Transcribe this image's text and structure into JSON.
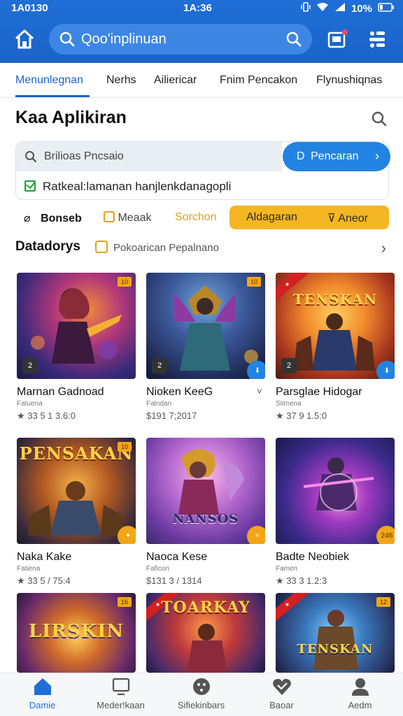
{
  "status": {
    "time_left": "1A0130",
    "time_mid": "1A:36",
    "battery": "10%"
  },
  "header": {
    "search_placeholder": "Qoo'inplinuan"
  },
  "tabs": [
    {
      "label": "Menunlegnan",
      "active": true
    },
    {
      "label": "Nerhs",
      "active": false
    },
    {
      "label": "Ailiericar",
      "active": false
    },
    {
      "label": "Fnim Pencakon",
      "active": false
    },
    {
      "label": "Flynushiqnas",
      "active": false
    }
  ],
  "section": {
    "title": "Kaa Aplikiran"
  },
  "promo": {
    "input_text": "Brilioas Pncsaio",
    "button_label": "Pencaran",
    "button_prefix": "D",
    "note": "Ratkeal:lamanan hanjlenkdanagopli"
  },
  "chips": {
    "c1": "Bonseb",
    "c2": "Meaak",
    "c3": "Sorchon",
    "c4": "Aldagaran",
    "c5": "Aneor"
  },
  "category": {
    "title": "Datadorys",
    "subtitle": "Pokoarican Pepalnano"
  },
  "colors": {
    "accent": "#1f6fd6",
    "chip_highlight": "#f5b623",
    "button_blue": "#2383e2"
  },
  "cards": [
    {
      "name": "Marnan Gadnoad",
      "sub": "Fatuena",
      "meta": "★ 33 5 1 3.6:0",
      "badge": "10",
      "corner": "2"
    },
    {
      "name": "Nioken KeeG",
      "sub": "Falndan",
      "meta": "$191 7;2017",
      "badge": "10",
      "corner": "2"
    },
    {
      "name": "Parsglae Hidogar",
      "sub": "Sitmena",
      "meta": "★ 37 9 1.5:0",
      "badge": "",
      "corner": "2",
      "art": "TENSKAN"
    },
    {
      "name": "Naka Kake",
      "sub": "Fatiena",
      "meta": "★ 33 5 / 75:4",
      "badge": "10",
      "corner": "",
      "art": "PENSAKAN"
    },
    {
      "name": "Naoca Kese",
      "sub": "Faficon",
      "meta": "$131 3 / 1314",
      "badge": "",
      "corner": "",
      "art": "NANSOS"
    },
    {
      "name": "Badte Neobiek",
      "sub": "Famen",
      "meta": "★ 33 3 1.2:3",
      "badge": "",
      "corner": "",
      "round": "246"
    },
    {
      "name": "",
      "sub": "",
      "meta": "",
      "badge": "16",
      "art": "LIRSKIN"
    },
    {
      "name": "",
      "sub": "",
      "meta": "",
      "badge": "",
      "art": "TOARKAY"
    },
    {
      "name": "",
      "sub": "",
      "meta": "",
      "badge": "12",
      "art": "TENSKAN"
    }
  ],
  "nav": [
    {
      "label": "Damie",
      "active": true
    },
    {
      "label": "Meder!kaan",
      "active": false
    },
    {
      "label": "Sifiekinbars",
      "active": false
    },
    {
      "label": "Baoar",
      "active": false
    },
    {
      "label": "Aedm",
      "active": false
    }
  ]
}
